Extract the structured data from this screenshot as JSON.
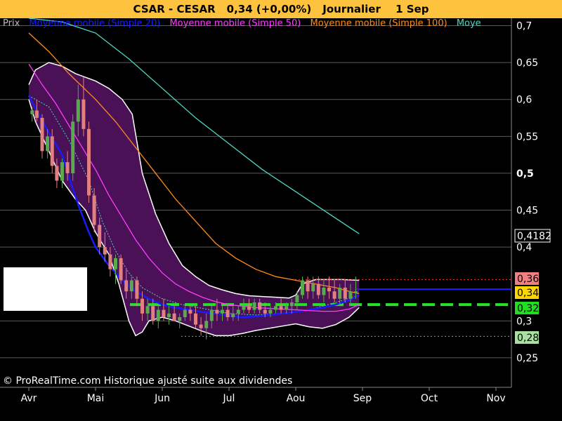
{
  "header": {
    "symbol": "CSAR - CESAR",
    "price": "0,34 (+0,00%)",
    "period": "Journalier",
    "date": "1 Sep"
  },
  "legend": [
    {
      "label": "Prix",
      "color": "#b9b9b9"
    },
    {
      "label": "Moyenne mobile (Simple 20)",
      "color": "#1a1aff"
    },
    {
      "label": "Moyenne mobile (Simple 50)",
      "color": "#ff3cff"
    },
    {
      "label": "Moyenne mobile (Simple 100)",
      "color": "#ff8c1a"
    },
    {
      "label": "Moye",
      "color": "#4fd6c6"
    }
  ],
  "footer": "© ProRealTime.com Historique ajusté suite aux dividendes",
  "colors": {
    "background": "#000000",
    "title_bg": "#fdc33f",
    "bollinger_fill": "#4a1157",
    "bollinger_edge": "#ffffff",
    "candle_up": "#5aa850",
    "candle_down": "#e08080",
    "grid": "#5a5a5a",
    "support": "#22e622",
    "resistance": "#ff3030",
    "low_line": "#44cc44"
  },
  "chart_data": {
    "type": "line",
    "y_axis": {
      "range": [
        0.21,
        0.71
      ],
      "ticks": [
        "0,7",
        "0,65",
        "0,6",
        "0,55",
        "0,5",
        "0,45",
        "0,4",
        "0,3",
        "0,25"
      ],
      "tick_values": [
        0.7,
        0.65,
        0.6,
        0.55,
        0.5,
        0.45,
        0.4,
        0.3,
        0.25
      ]
    },
    "x_axis": {
      "labels": [
        "Avr",
        "Mai",
        "Jun",
        "Jul",
        "Aou",
        "Sep",
        "Oct",
        "Nov"
      ],
      "months_index": [
        0,
        1,
        2,
        3,
        4,
        5,
        6,
        7
      ]
    },
    "price_labels": [
      {
        "text": "0,4182",
        "value": 0.4182,
        "bg": "#000000",
        "fg": "#ffffff",
        "border": "#ffffff"
      },
      {
        "text": "0,36",
        "value": 0.36,
        "bg": "#f08080",
        "fg": "#000000"
      },
      {
        "text": "0,34",
        "value": 0.34,
        "bg": "#ffd700",
        "fg": "#000000"
      },
      {
        "text": "0,32",
        "value": 0.322,
        "bg": "#22dd22",
        "fg": "#000000"
      },
      {
        "text": "0,28",
        "value": 0.28,
        "bg": "#a8e0a0",
        "fg": "#000000"
      }
    ],
    "horizontal_lines": [
      {
        "name": "resistance",
        "value": 0.356,
        "style": "dotted",
        "color": "#ff3030"
      },
      {
        "name": "last-price",
        "value": 0.343,
        "style": "solid",
        "color": "#2020ff"
      },
      {
        "name": "support",
        "value": 0.322,
        "style": "dashed",
        "color": "#22e622"
      },
      {
        "name": "low",
        "value": 0.279,
        "style": "dotted",
        "color": "#44cc44"
      }
    ],
    "series": [
      {
        "name": "Moyenne mobile (Simple 20)",
        "color": "#1a1aff",
        "points": [
          [
            0,
            0.605
          ],
          [
            0.15,
            0.58
          ],
          [
            0.3,
            0.555
          ],
          [
            0.5,
            0.525
          ],
          [
            0.6,
            0.495
          ],
          [
            0.75,
            0.455
          ],
          [
            0.9,
            0.42
          ],
          [
            1,
            0.4
          ],
          [
            1.2,
            0.375
          ],
          [
            1.4,
            0.355
          ],
          [
            1.6,
            0.34
          ],
          [
            1.8,
            0.33
          ],
          [
            2,
            0.322
          ],
          [
            2.2,
            0.318
          ],
          [
            2.4,
            0.315
          ],
          [
            2.6,
            0.312
          ],
          [
            2.8,
            0.31
          ],
          [
            3,
            0.307
          ],
          [
            3.2,
            0.305
          ],
          [
            3.4,
            0.306
          ],
          [
            3.6,
            0.308
          ],
          [
            3.8,
            0.31
          ],
          [
            4,
            0.312
          ],
          [
            4.2,
            0.315
          ],
          [
            4.4,
            0.318
          ],
          [
            4.6,
            0.322
          ],
          [
            4.8,
            0.328
          ],
          [
            4.95,
            0.335
          ]
        ]
      },
      {
        "name": "Moyenne mobile (Simple 50)",
        "color": "#ff3cff",
        "points": [
          [
            0,
            0.648
          ],
          [
            0.2,
            0.62
          ],
          [
            0.4,
            0.595
          ],
          [
            0.6,
            0.565
          ],
          [
            0.8,
            0.535
          ],
          [
            1,
            0.505
          ],
          [
            1.2,
            0.47
          ],
          [
            1.4,
            0.44
          ],
          [
            1.6,
            0.41
          ],
          [
            1.8,
            0.385
          ],
          [
            2,
            0.365
          ],
          [
            2.2,
            0.35
          ],
          [
            2.4,
            0.34
          ],
          [
            2.6,
            0.332
          ],
          [
            2.8,
            0.326
          ],
          [
            3,
            0.322
          ],
          [
            3.2,
            0.32
          ],
          [
            3.4,
            0.318
          ],
          [
            3.6,
            0.317
          ],
          [
            3.8,
            0.316
          ],
          [
            4,
            0.315
          ],
          [
            4.2,
            0.314
          ],
          [
            4.4,
            0.313
          ],
          [
            4.6,
            0.313
          ],
          [
            4.8,
            0.316
          ],
          [
            4.95,
            0.322
          ]
        ]
      },
      {
        "name": "Moyenne mobile (Simple 100)",
        "color": "#ff8c1a",
        "points": [
          [
            0,
            0.69
          ],
          [
            0.3,
            0.665
          ],
          [
            0.6,
            0.635
          ],
          [
            1,
            0.6
          ],
          [
            1.3,
            0.57
          ],
          [
            1.6,
            0.535
          ],
          [
            1.9,
            0.5
          ],
          [
            2.2,
            0.465
          ],
          [
            2.5,
            0.435
          ],
          [
            2.8,
            0.405
          ],
          [
            3.1,
            0.385
          ],
          [
            3.4,
            0.37
          ],
          [
            3.7,
            0.36
          ],
          [
            4,
            0.355
          ],
          [
            4.3,
            0.35
          ],
          [
            4.6,
            0.345
          ],
          [
            4.8,
            0.34
          ],
          [
            4.95,
            0.337
          ]
        ]
      },
      {
        "name": "Moye",
        "color": "#4fd6c6",
        "points": [
          [
            0,
            0.71
          ],
          [
            0.5,
            0.705
          ],
          [
            1,
            0.69
          ],
          [
            1.5,
            0.655
          ],
          [
            2,
            0.615
          ],
          [
            2.5,
            0.575
          ],
          [
            3,
            0.54
          ],
          [
            3.5,
            0.505
          ],
          [
            4,
            0.475
          ],
          [
            4.5,
            0.445
          ],
          [
            4.95,
            0.418
          ]
        ]
      }
    ],
    "bollinger": {
      "upper": [
        [
          0,
          0.62
        ],
        [
          0.1,
          0.64
        ],
        [
          0.3,
          0.65
        ],
        [
          0.5,
          0.645
        ],
        [
          0.7,
          0.635
        ],
        [
          0.85,
          0.63
        ],
        [
          1,
          0.625
        ],
        [
          1.2,
          0.615
        ],
        [
          1.4,
          0.6
        ],
        [
          1.55,
          0.58
        ],
        [
          1.7,
          0.5
        ],
        [
          1.9,
          0.445
        ],
        [
          2.1,
          0.405
        ],
        [
          2.3,
          0.375
        ],
        [
          2.5,
          0.36
        ],
        [
          2.7,
          0.348
        ],
        [
          2.9,
          0.342
        ],
        [
          3.1,
          0.337
        ],
        [
          3.3,
          0.334
        ],
        [
          3.5,
          0.333
        ],
        [
          3.7,
          0.332
        ],
        [
          3.9,
          0.331
        ],
        [
          4.0,
          0.335
        ],
        [
          4.1,
          0.35
        ],
        [
          4.3,
          0.356
        ],
        [
          4.5,
          0.356
        ],
        [
          4.7,
          0.356
        ],
        [
          4.95,
          0.355
        ]
      ],
      "lower": [
        [
          0,
          0.6
        ],
        [
          0.1,
          0.57
        ],
        [
          0.3,
          0.53
        ],
        [
          0.5,
          0.49
        ],
        [
          0.7,
          0.465
        ],
        [
          0.85,
          0.45
        ],
        [
          1,
          0.42
        ],
        [
          1.2,
          0.39
        ],
        [
          1.35,
          0.35
        ],
        [
          1.5,
          0.3
        ],
        [
          1.6,
          0.28
        ],
        [
          1.7,
          0.285
        ],
        [
          1.8,
          0.3
        ],
        [
          2.0,
          0.305
        ],
        [
          2.2,
          0.3
        ],
        [
          2.4,
          0.293
        ],
        [
          2.6,
          0.286
        ],
        [
          2.8,
          0.28
        ],
        [
          3.0,
          0.28
        ],
        [
          3.2,
          0.283
        ],
        [
          3.4,
          0.287
        ],
        [
          3.6,
          0.29
        ],
        [
          3.8,
          0.293
        ],
        [
          4.0,
          0.296
        ],
        [
          4.2,
          0.292
        ],
        [
          4.4,
          0.29
        ],
        [
          4.6,
          0.295
        ],
        [
          4.8,
          0.305
        ],
        [
          4.95,
          0.318
        ]
      ],
      "mid": [
        [
          0,
          0.605
        ],
        [
          0.3,
          0.59
        ],
        [
          0.6,
          0.545
        ],
        [
          0.9,
          0.49
        ],
        [
          1.1,
          0.435
        ],
        [
          1.3,
          0.395
        ],
        [
          1.5,
          0.365
        ],
        [
          1.7,
          0.345
        ],
        [
          2,
          0.33
        ],
        [
          2.3,
          0.322
        ],
        [
          2.6,
          0.317
        ],
        [
          3,
          0.31
        ],
        [
          3.4,
          0.308
        ],
        [
          3.8,
          0.31
        ],
        [
          4.2,
          0.315
        ],
        [
          4.6,
          0.325
        ],
        [
          4.95,
          0.335
        ]
      ]
    },
    "candles_ohlc_sample_note": "",
    "candles": [
      [
        0.05,
        0.58,
        0.59,
        0.57,
        0.585
      ],
      [
        0.12,
        0.585,
        0.6,
        0.57,
        0.575
      ],
      [
        0.2,
        0.575,
        0.58,
        0.52,
        0.53
      ],
      [
        0.28,
        0.53,
        0.56,
        0.52,
        0.55
      ],
      [
        0.35,
        0.55,
        0.56,
        0.5,
        0.51
      ],
      [
        0.42,
        0.51,
        0.52,
        0.48,
        0.49
      ],
      [
        0.5,
        0.49,
        0.52,
        0.48,
        0.515
      ],
      [
        0.58,
        0.515,
        0.53,
        0.49,
        0.5
      ],
      [
        0.66,
        0.5,
        0.58,
        0.49,
        0.57
      ],
      [
        0.74,
        0.57,
        0.62,
        0.55,
        0.6
      ],
      [
        0.82,
        0.6,
        0.63,
        0.55,
        0.56
      ],
      [
        0.9,
        0.56,
        0.57,
        0.46,
        0.47
      ],
      [
        0.98,
        0.47,
        0.48,
        0.42,
        0.43
      ],
      [
        1.06,
        0.43,
        0.44,
        0.39,
        0.4
      ],
      [
        1.14,
        0.4,
        0.42,
        0.38,
        0.39
      ],
      [
        1.22,
        0.39,
        0.4,
        0.36,
        0.37
      ],
      [
        1.3,
        0.37,
        0.39,
        0.35,
        0.385
      ],
      [
        1.38,
        0.385,
        0.39,
        0.35,
        0.355
      ],
      [
        1.46,
        0.355,
        0.37,
        0.33,
        0.34
      ],
      [
        1.54,
        0.34,
        0.36,
        0.33,
        0.355
      ],
      [
        1.62,
        0.355,
        0.36,
        0.32,
        0.33
      ],
      [
        1.7,
        0.33,
        0.34,
        0.3,
        0.31
      ],
      [
        1.78,
        0.31,
        0.33,
        0.3,
        0.32
      ],
      [
        1.86,
        0.32,
        0.33,
        0.295,
        0.3
      ],
      [
        1.94,
        0.3,
        0.32,
        0.29,
        0.315
      ],
      [
        2.02,
        0.315,
        0.33,
        0.3,
        0.305
      ],
      [
        2.1,
        0.305,
        0.32,
        0.295,
        0.31
      ],
      [
        2.18,
        0.31,
        0.32,
        0.3,
        0.3
      ],
      [
        2.26,
        0.3,
        0.31,
        0.29,
        0.305
      ],
      [
        2.34,
        0.305,
        0.32,
        0.3,
        0.315
      ],
      [
        2.42,
        0.315,
        0.32,
        0.3,
        0.31
      ],
      [
        2.5,
        0.31,
        0.32,
        0.29,
        0.295
      ],
      [
        2.58,
        0.295,
        0.305,
        0.28,
        0.29
      ],
      [
        2.66,
        0.29,
        0.31,
        0.275,
        0.3
      ],
      [
        2.74,
        0.3,
        0.32,
        0.29,
        0.315
      ],
      [
        2.82,
        0.315,
        0.33,
        0.3,
        0.31
      ],
      [
        2.9,
        0.31,
        0.32,
        0.3,
        0.315
      ],
      [
        2.98,
        0.315,
        0.32,
        0.3,
        0.305
      ],
      [
        3.06,
        0.305,
        0.32,
        0.3,
        0.31
      ],
      [
        3.14,
        0.31,
        0.32,
        0.3,
        0.315
      ],
      [
        3.22,
        0.315,
        0.33,
        0.31,
        0.32
      ],
      [
        3.3,
        0.32,
        0.33,
        0.31,
        0.315
      ],
      [
        3.38,
        0.315,
        0.33,
        0.31,
        0.325
      ],
      [
        3.46,
        0.325,
        0.33,
        0.31,
        0.315
      ],
      [
        3.54,
        0.315,
        0.325,
        0.305,
        0.31
      ],
      [
        3.62,
        0.31,
        0.32,
        0.305,
        0.315
      ],
      [
        3.7,
        0.315,
        0.325,
        0.31,
        0.32
      ],
      [
        3.78,
        0.32,
        0.33,
        0.31,
        0.315
      ],
      [
        3.86,
        0.315,
        0.325,
        0.31,
        0.32
      ],
      [
        3.94,
        0.32,
        0.33,
        0.31,
        0.325
      ],
      [
        4.02,
        0.325,
        0.34,
        0.315,
        0.335
      ],
      [
        4.1,
        0.335,
        0.36,
        0.33,
        0.355
      ],
      [
        4.18,
        0.355,
        0.36,
        0.33,
        0.34
      ],
      [
        4.26,
        0.34,
        0.36,
        0.33,
        0.35
      ],
      [
        4.34,
        0.35,
        0.36,
        0.33,
        0.335
      ],
      [
        4.42,
        0.335,
        0.355,
        0.325,
        0.345
      ],
      [
        4.5,
        0.345,
        0.36,
        0.33,
        0.34
      ],
      [
        4.58,
        0.34,
        0.355,
        0.325,
        0.33
      ],
      [
        4.66,
        0.33,
        0.35,
        0.32,
        0.345
      ],
      [
        4.74,
        0.345,
        0.355,
        0.325,
        0.33
      ],
      [
        4.82,
        0.33,
        0.35,
        0.32,
        0.34
      ],
      [
        4.9,
        0.34,
        0.36,
        0.33,
        0.34
      ]
    ]
  }
}
